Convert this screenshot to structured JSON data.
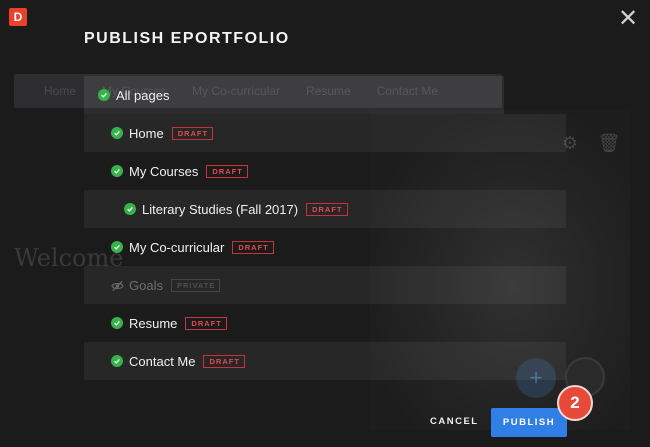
{
  "app": {
    "logo_letter": "D"
  },
  "modal": {
    "title": "PUBLISH EPORTFOLIO",
    "close_icon": "close-icon"
  },
  "background": {
    "nav": [
      "Home",
      "My Courses",
      "My Co-curricular",
      "Resume",
      "Contact Me"
    ],
    "welcome": "Welcome"
  },
  "pages": [
    {
      "label": "All pages",
      "status": "published",
      "badge": ""
    },
    {
      "label": "Home",
      "status": "published",
      "badge": "DRAFT"
    },
    {
      "label": "My Courses",
      "status": "published",
      "badge": "DRAFT"
    },
    {
      "label": "Literary Studies (Fall 2017)",
      "status": "published",
      "badge": "DRAFT"
    },
    {
      "label": "My Co-curricular",
      "status": "published",
      "badge": "DRAFT"
    },
    {
      "label": "Goals",
      "status": "hidden",
      "badge": "PRIVATE"
    },
    {
      "label": "Resume",
      "status": "published",
      "badge": "DRAFT"
    },
    {
      "label": "Contact Me",
      "status": "published",
      "badge": "DRAFT"
    }
  ],
  "footer": {
    "cancel_label": "CANCEL",
    "publish_label": "PUBLISH",
    "step_number": "2"
  },
  "colors": {
    "accent_blue": "#2f7fe6",
    "check_green": "#37b34a",
    "draft_red": "#c8323a",
    "step_badge": "#e84a3a"
  }
}
